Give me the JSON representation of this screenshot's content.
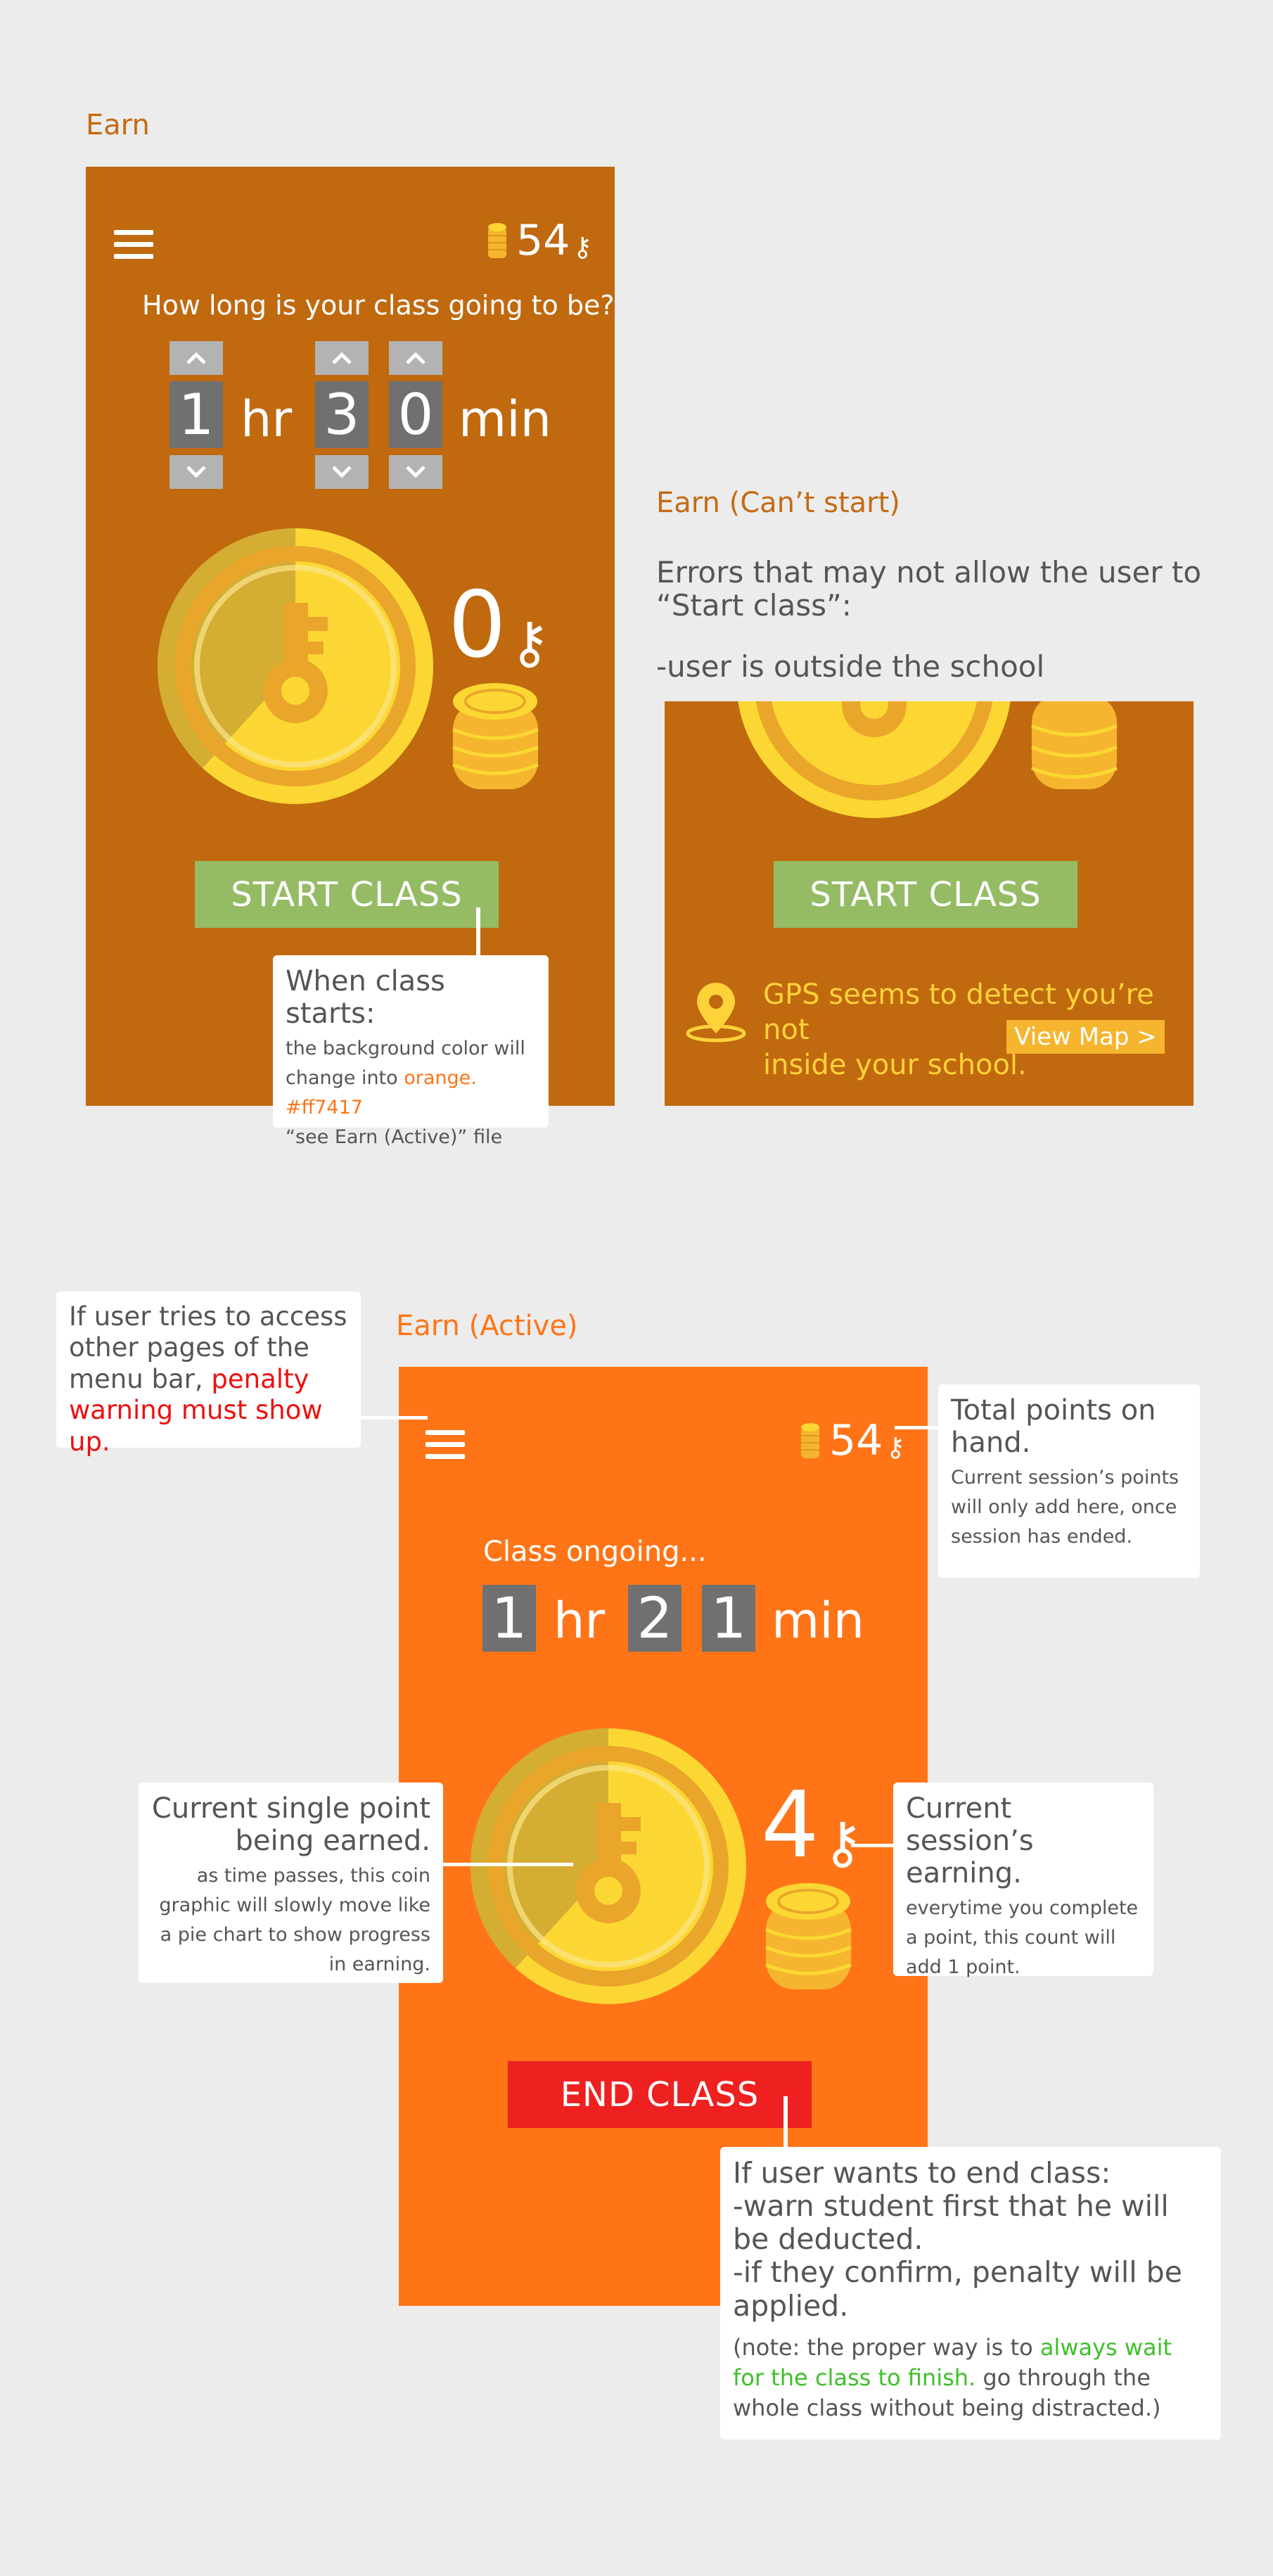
{
  "sections": {
    "earn_title": "Earn",
    "cant_title": "Earn (Can’t start)",
    "active_title": "Earn (Active)"
  },
  "earn": {
    "points": "54",
    "key_symbol": "⚷",
    "question": "How long is your class going to be?",
    "hours_digit": "1",
    "hours_unit": "hr",
    "minutes_tens": "3",
    "minutes_ones": "0",
    "minutes_unit": "min",
    "session_count": "0",
    "start_button": "START CLASS"
  },
  "earn_callout": {
    "head": "When class starts:",
    "line1": "the background color will",
    "line2_prefix": "change into ",
    "line2_highlight": "orange. #ff7417",
    "line3": "“see Earn (Active)” file"
  },
  "cant": {
    "errors_line1": "Errors that may not allow the user to",
    "errors_line2": "“Start class”:",
    "errors_reason": "-user is outside the school",
    "start_button": "START CLASS",
    "gps_line1": "GPS seems to detect you’re not",
    "gps_line2": "inside your school.",
    "view_map": "View Map >"
  },
  "active": {
    "points": "54",
    "key_symbol": "⚷",
    "ongoing": "Class ongoing...",
    "hours_digit": "1",
    "hours_unit": "hr",
    "minutes_tens": "2",
    "minutes_ones": "1",
    "minutes_unit": "min",
    "session_count": "4",
    "end_button": "END CLASS"
  },
  "callouts": {
    "menu": {
      "line1": "If user tries to access",
      "line2": "other pages of the",
      "line3_prefix": "menu bar, ",
      "line3_highlight": "penalty",
      "line4_highlight": "warning must show up."
    },
    "points": {
      "head": "Total points on hand.",
      "body": "Current session’s points will only add here, once session has ended."
    },
    "single_point": {
      "head": "Current single point being earned.",
      "body": "as time passes, this coin graphic will slowly move like a pie chart to show progress in earning."
    },
    "session": {
      "head": "Current session’s earning.",
      "body": "everytime you complete a point, this count will add 1 point."
    },
    "end": {
      "head1": "If user wants to end class:",
      "head2": "-warn student first that he will be deducted.",
      "head3": "-if they confirm, penalty will be applied.",
      "note_prefix": "(note: the proper way is to ",
      "note_highlight": "always wait for the class to finish.",
      "note_suffix": " go through the whole class without being distracted.)"
    }
  },
  "colors": {
    "earn_bg": "#c0690f",
    "active_bg": "#ff7417",
    "start_button": "#95bb64",
    "end_button": "#ee2020",
    "coin": "#fcd733",
    "page_bg": "#ececec"
  }
}
